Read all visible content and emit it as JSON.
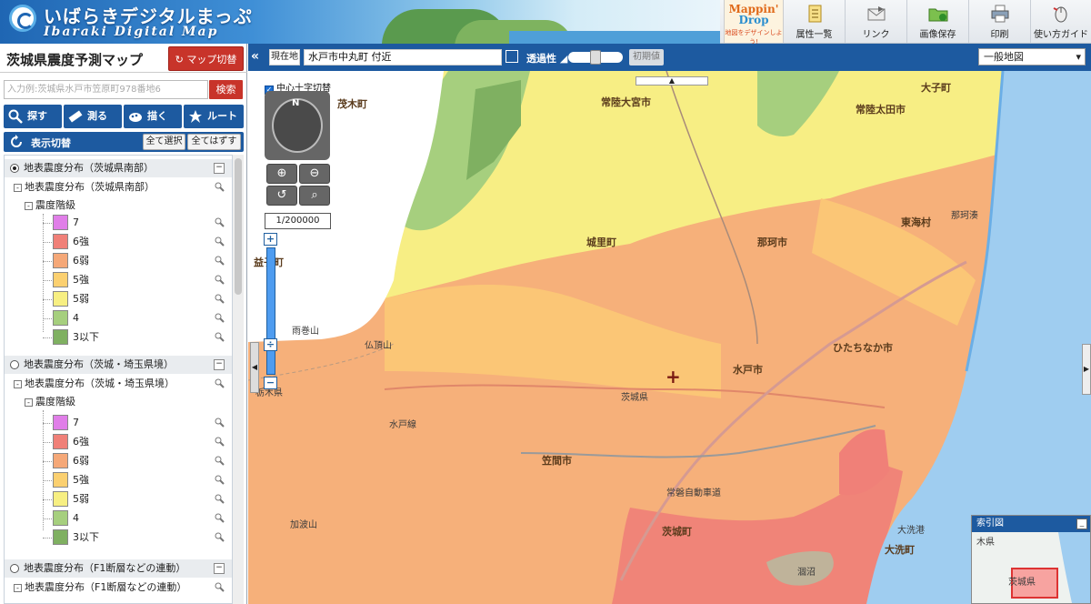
{
  "header": {
    "logo_title": "いばらきデジタルまっぷ",
    "logo_subtitle": "Ibaraki Digital Map",
    "mappin_line1": "Mappin'",
    "mappin_line2": "Drop",
    "mappin_tagline": "地図をデザインしよう!",
    "buttons": [
      {
        "label": "属性一覧",
        "icon": "document-list-icon"
      },
      {
        "label": "リンク",
        "icon": "link-mail-icon"
      },
      {
        "label": "画像保存",
        "icon": "folder-save-icon"
      },
      {
        "label": "印刷",
        "icon": "printer-icon"
      },
      {
        "label": "使い方ガイド",
        "icon": "mouse-guide-icon"
      }
    ]
  },
  "left_panel": {
    "title": "茨城県震度予測マップ",
    "map_switch_label": "マップ切替",
    "search_placeholder": "入力例:茨城県水戸市笠原町978番地6",
    "search_button": "検索",
    "tools": [
      "探す",
      "測る",
      "描く",
      "ルート"
    ],
    "display_toggle": "表示切替",
    "select_all": "全て選択",
    "deselect_all": "全てはずす",
    "groups": [
      {
        "label": "地表震度分布（茨城県南部）",
        "selected": true,
        "layer": "地表震度分布（茨城県南部）",
        "sub": "震度階級"
      },
      {
        "label": "地表震度分布（茨城・埼玉県境）",
        "selected": false,
        "layer": "地表震度分布（茨城・埼玉県境）",
        "sub": "震度階級"
      },
      {
        "label": "地表震度分布（F1断層などの連動）",
        "selected": false,
        "layer": "地表震度分布（F1断層などの連動）"
      }
    ],
    "legend": [
      {
        "label": "7",
        "color": "#e07ee8"
      },
      {
        "label": "6強",
        "color": "#f08078"
      },
      {
        "label": "6弱",
        "color": "#f5a878"
      },
      {
        "label": "5強",
        "color": "#fbd070"
      },
      {
        "label": "5弱",
        "color": "#f7ef82"
      },
      {
        "label": "4",
        "color": "#a6cf7e"
      },
      {
        "label": "3以下",
        "color": "#7fb061"
      }
    ]
  },
  "map_bar": {
    "collapse": "«",
    "current_label": "現在地",
    "current_location": "水戸市中丸町 付近",
    "transparency_label": "透過性",
    "init_button": "初期値",
    "basemap_select": "一般地図"
  },
  "map": {
    "crosshair_toggle": "中心十字切替",
    "compass_north": "N",
    "scale": "1/200000",
    "labels": [
      "茂木町",
      "常陸大宮市",
      "常陸太田市",
      "城里町",
      "那珂市",
      "東海村",
      "水戸市",
      "ひたちなか市",
      "笠間市",
      "茨城町",
      "大洗町",
      "大子町",
      "益子町",
      "雨巻山",
      "仏頂山",
      "加波山",
      "那珂湊",
      "大洗港",
      "涸沼",
      "常磐自動車道",
      "水戸線",
      "茨城県",
      "栃木県"
    ],
    "index_title": "索引図",
    "index_collapse": "_",
    "index_labels": [
      "木県",
      "茨城県"
    ]
  }
}
